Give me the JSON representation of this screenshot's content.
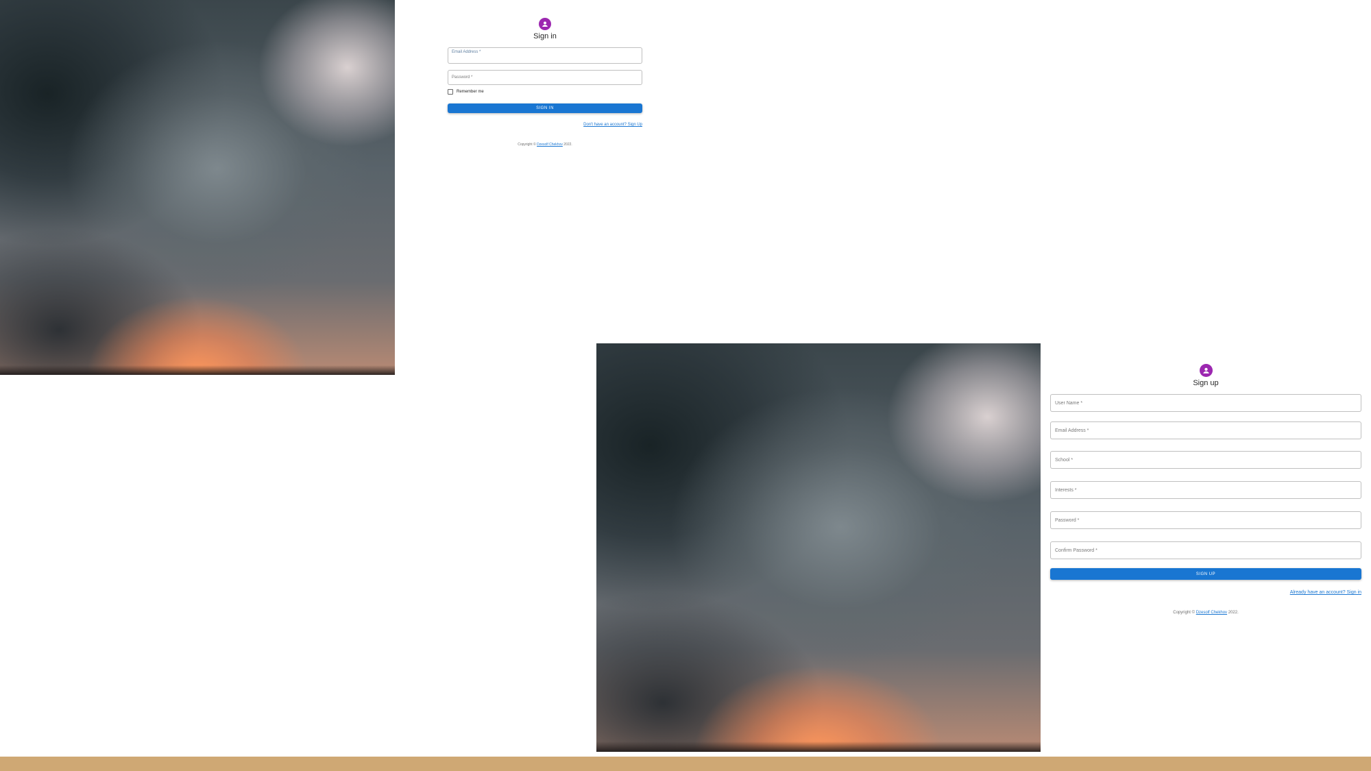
{
  "signin": {
    "title": "Sign in",
    "email_label": "Email Address *",
    "password_label": "Password *",
    "remember_label": "Remember me",
    "button_label": "SIGN IN",
    "signup_link": "Don't have an account? Sign Up",
    "copyright_prefix": "Copyright ©",
    "copyright_name": "Dzesolf Chekhov",
    "copyright_year": "2022."
  },
  "signup": {
    "title": "Sign up",
    "username_label": "User Name *",
    "email_label": "Email Address *",
    "school_label": "School *",
    "interests_label": "Interests *",
    "password_label": "Password *",
    "confirm_label": "Confirm Password *",
    "button_label": "SIGN UP",
    "signin_link": "Already have an account? Sign in",
    "copyright_prefix": "Copyright ©",
    "copyright_name": "Dzesolf Chekhov",
    "copyright_year": "2022."
  },
  "colors": {
    "primary": "#1976d2",
    "avatar": "#9c27b0",
    "bottom_bar": "#cfa874"
  },
  "icons": {
    "avatar": "person-icon"
  }
}
